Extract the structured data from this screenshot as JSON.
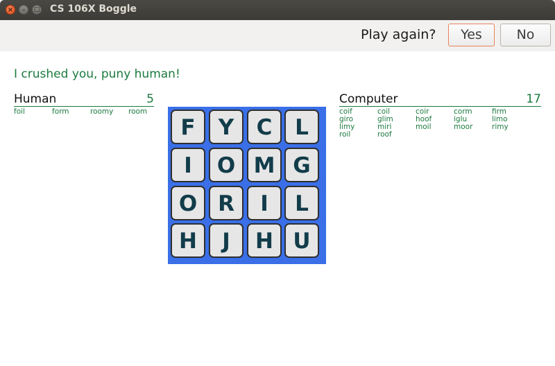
{
  "window": {
    "title": "CS 106X Boggle"
  },
  "toolbar": {
    "prompt": "Play again?",
    "yes_label": "Yes",
    "no_label": "No"
  },
  "message": "I crushed you, puny human!",
  "human": {
    "name": "Human",
    "score": "5",
    "words": [
      "foil",
      "form",
      "roomy",
      "room"
    ]
  },
  "computer": {
    "name": "Computer",
    "score": "17",
    "words": [
      "coif",
      "coil",
      "coir",
      "corm",
      "firm",
      "giro",
      "glim",
      "hoof",
      "iglu",
      "limo",
      "limy",
      "miri",
      "moil",
      "moor",
      "rimy",
      "roil",
      "roof"
    ]
  },
  "board": {
    "rows": [
      [
        "F",
        "Y",
        "C",
        "L"
      ],
      [
        "I",
        "O",
        "M",
        "G"
      ],
      [
        "O",
        "R",
        "I",
        "L"
      ],
      [
        "H",
        "J",
        "H",
        "U"
      ]
    ]
  },
  "colors": {
    "board_bg": "#3a6fe8",
    "accent_green": "#1b7a3e",
    "letter": "#123c4a"
  }
}
